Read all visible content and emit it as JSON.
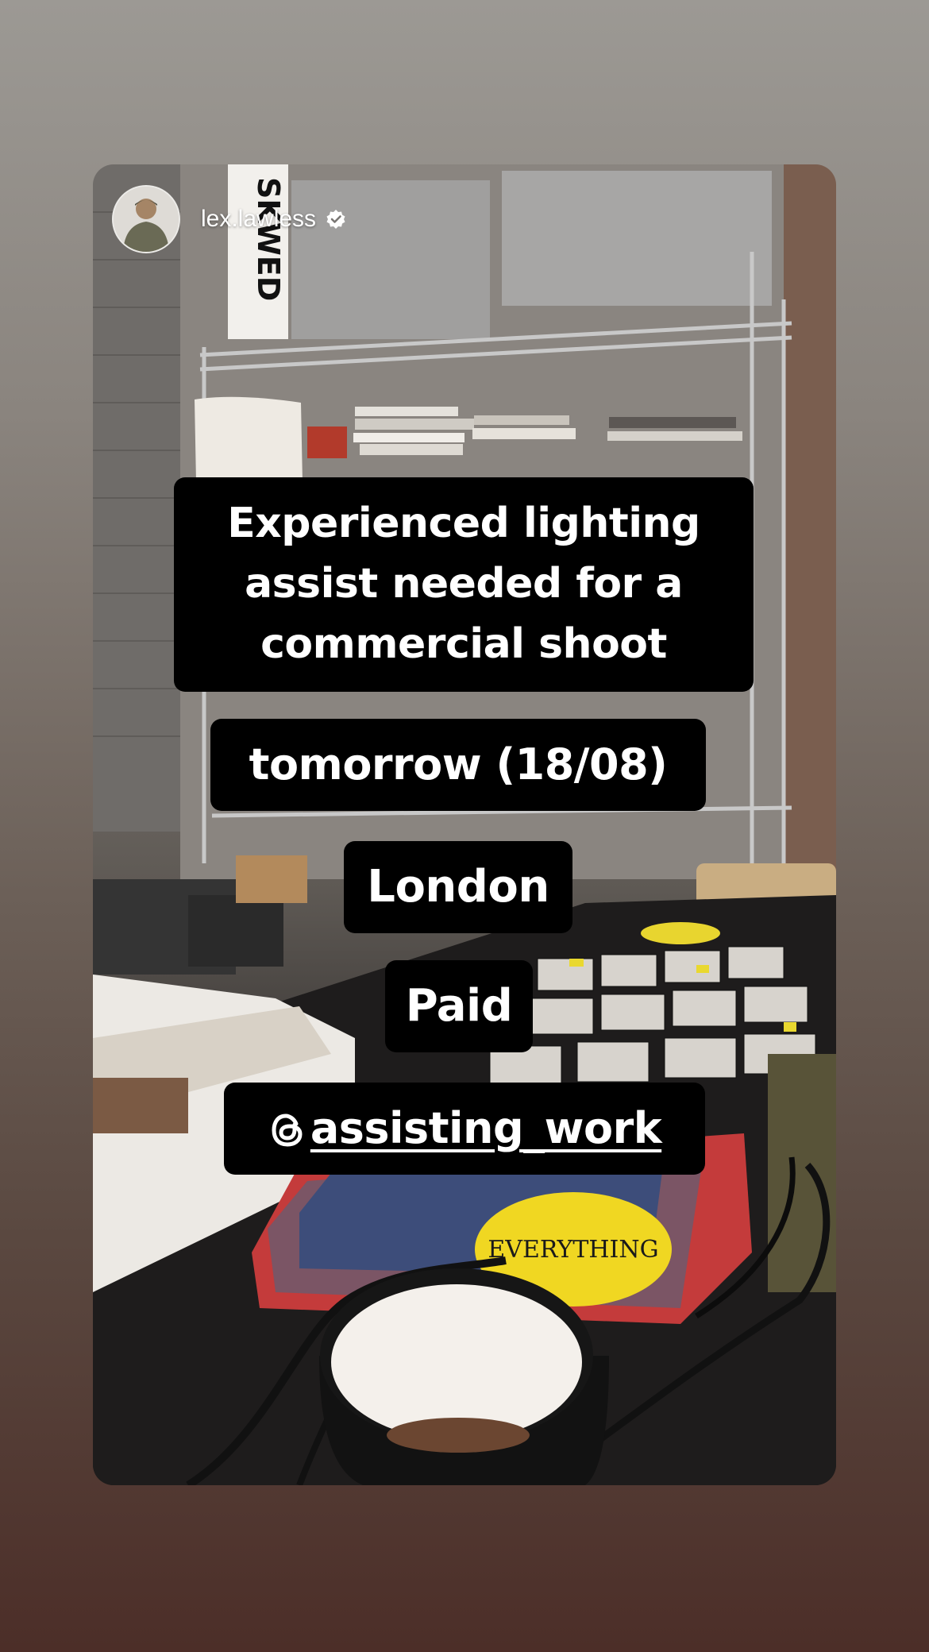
{
  "story": {
    "username": "lex.lawless",
    "verified": true,
    "captions": {
      "line1": "Experienced lighting",
      "line2": "assist needed for a",
      "line3": "commercial shoot",
      "date": "tomorrow (18/08)",
      "city": "London",
      "pay": "Paid",
      "handle": "assisting_work"
    },
    "sign_text": "SKWED",
    "sticker_text": "EVERYTHING"
  },
  "colors": {
    "caption_bg": "#000000",
    "caption_text": "#ffffff",
    "verified_badge": "#ffffff"
  },
  "icons": {
    "verified": "verified-badge-icon",
    "threads": "threads-icon"
  }
}
